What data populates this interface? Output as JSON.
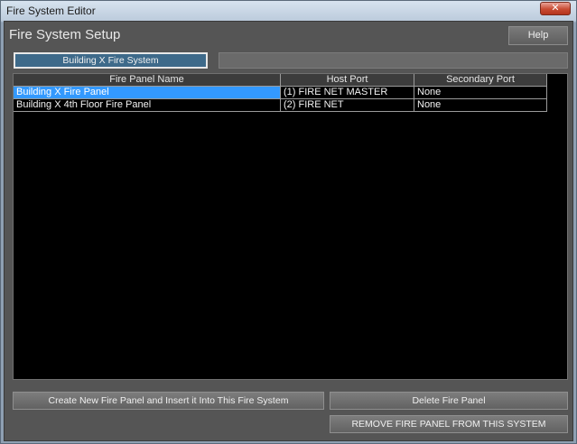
{
  "window": {
    "title": "Fire System Editor",
    "close_glyph": "✕"
  },
  "header": {
    "title": "Fire System Setup",
    "help_label": "Help"
  },
  "tabs": {
    "active_label": "Building X Fire System"
  },
  "table": {
    "columns": [
      "Fire Panel Name",
      "Host Port",
      "Secondary Port"
    ],
    "rows": [
      {
        "name": "Building X Fire Panel",
        "host_port": "(1) FIRE NET MASTER",
        "secondary_port": "None",
        "selected": true
      },
      {
        "name": "Building X 4th Floor Fire Panel",
        "host_port": "(2) FIRE NET",
        "secondary_port": "None",
        "selected": false
      }
    ]
  },
  "buttons": {
    "create_label": "Create New Fire Panel and Insert it Into This Fire System",
    "delete_label": "Delete Fire Panel",
    "remove_label": "REMOVE FIRE PANEL FROM THIS SYSTEM"
  },
  "colors": {
    "selection": "#3399ff",
    "tab_active": "#3e6a8a",
    "client_bg": "#555555",
    "grid_bg": "#000000"
  }
}
